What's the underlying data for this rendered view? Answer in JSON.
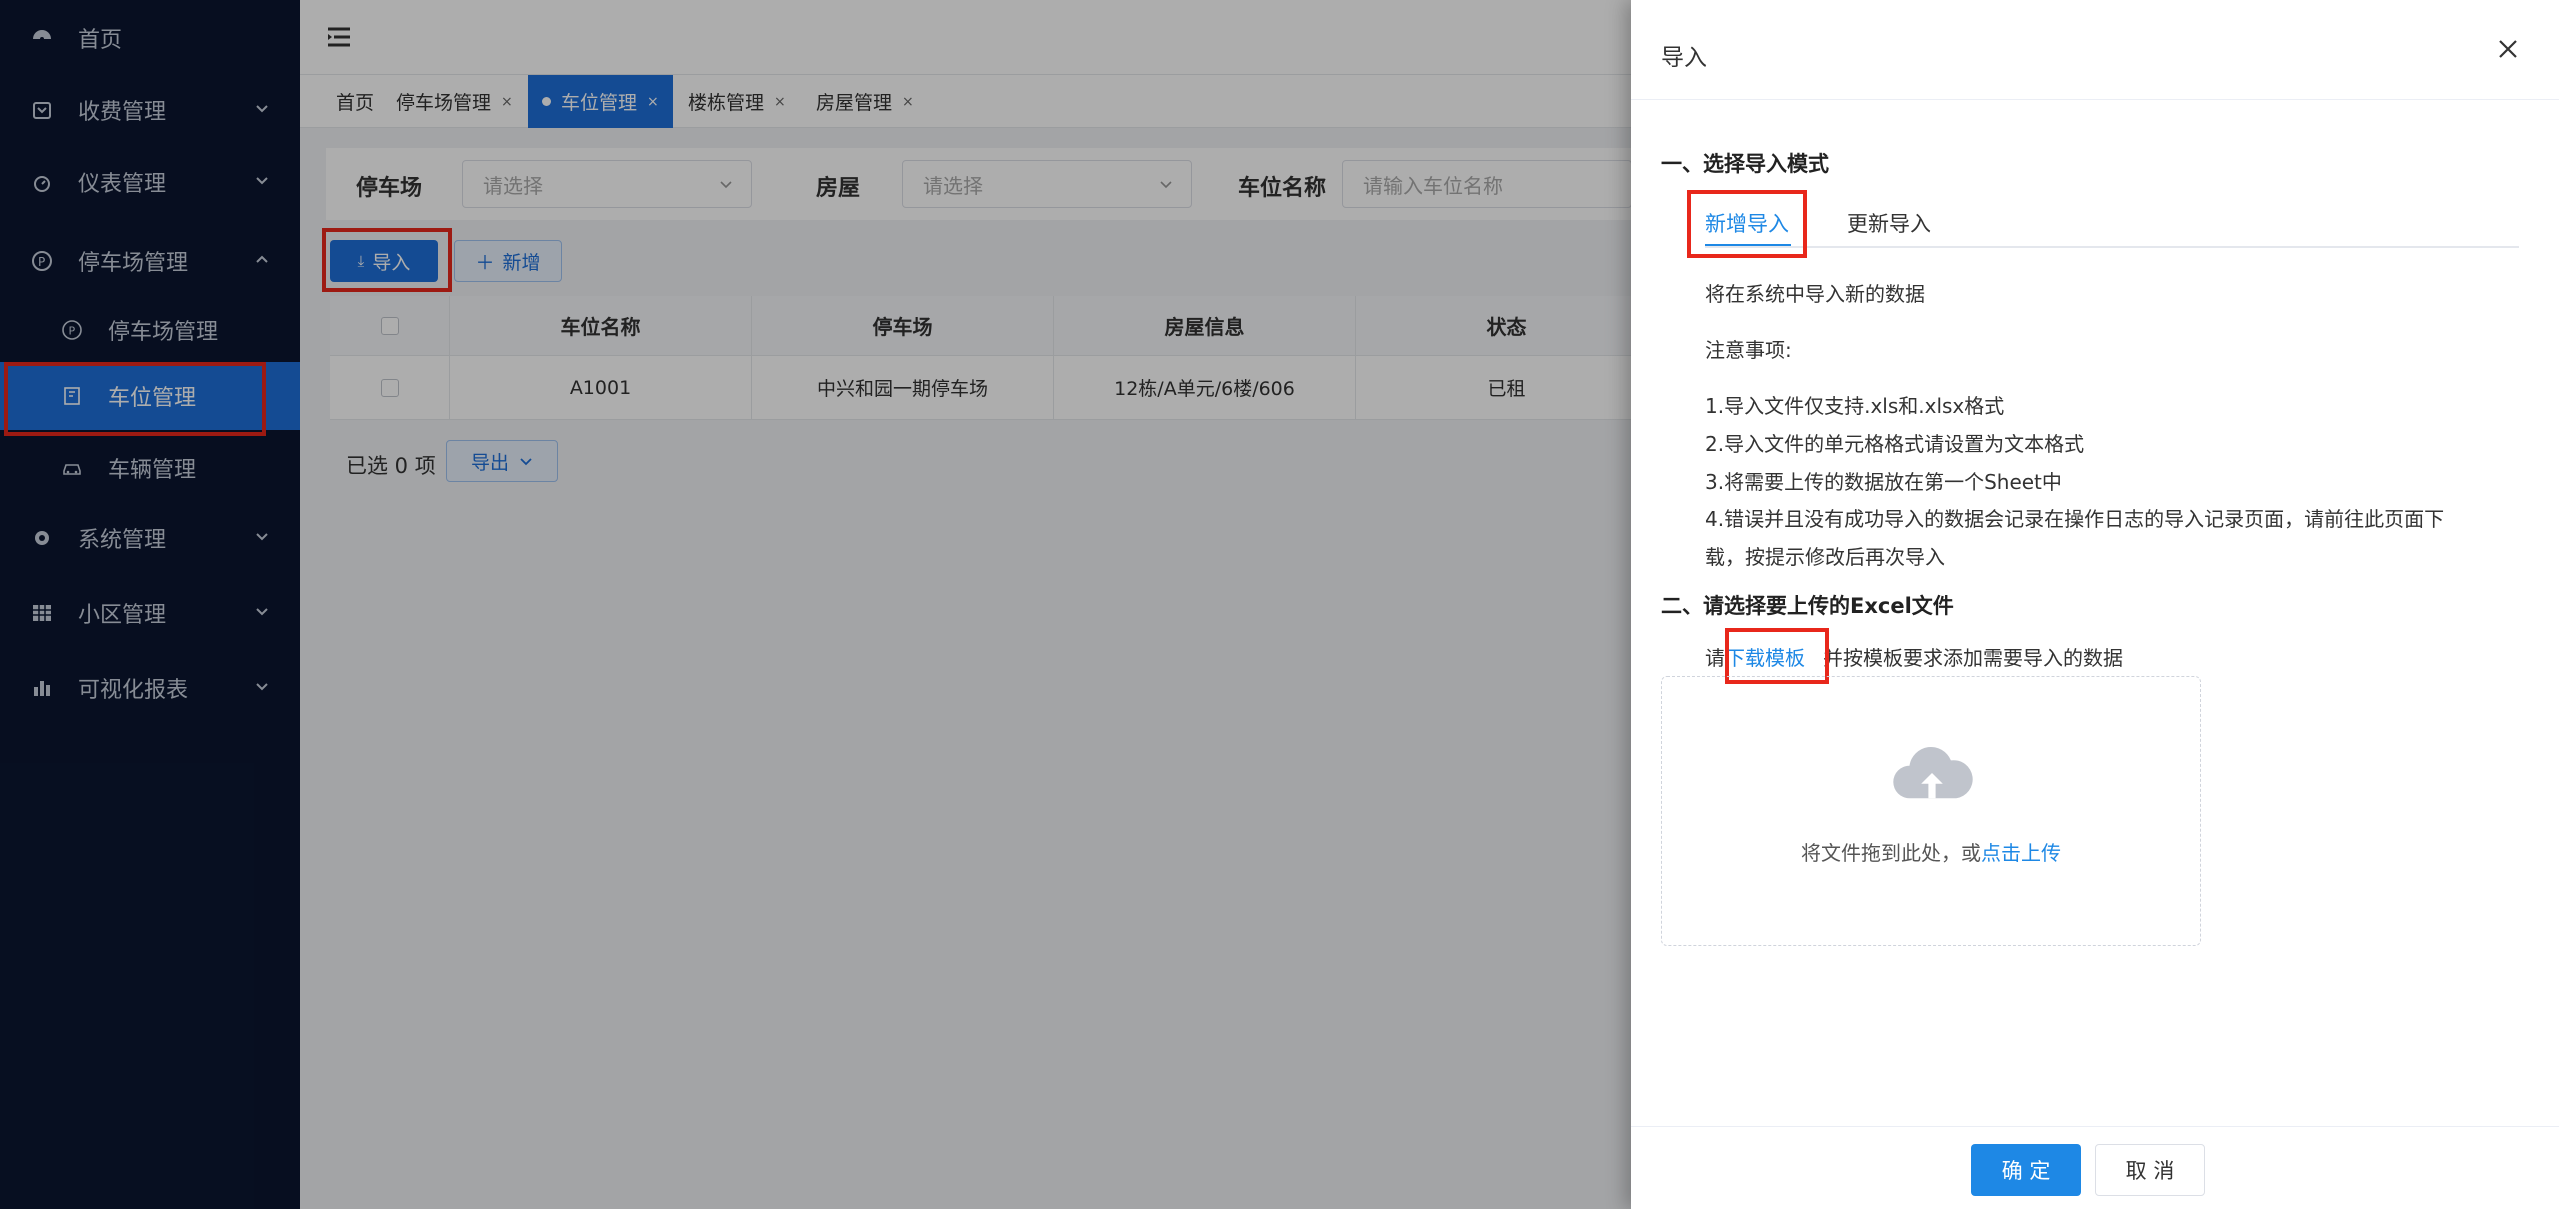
{
  "sidebar": {
    "items": [
      {
        "label": "首页",
        "icon": "dashboard-icon"
      },
      {
        "label": "收费管理",
        "icon": "wallet-icon"
      },
      {
        "label": "仪表管理",
        "icon": "gauge-icon"
      },
      {
        "label": "停车场管理",
        "icon": "parking-icon"
      },
      {
        "label": "停车场管理",
        "icon": "parking-circle-icon"
      },
      {
        "label": "车位管理",
        "icon": "parking-space-icon"
      },
      {
        "label": "车辆管理",
        "icon": "car-icon"
      },
      {
        "label": "系统管理",
        "icon": "gear-icon"
      },
      {
        "label": "小区管理",
        "icon": "grid-icon"
      },
      {
        "label": "可视化报表",
        "icon": "bar-chart-icon"
      }
    ]
  },
  "tabs": [
    {
      "label": "首页"
    },
    {
      "label": "停车场管理",
      "close": "×"
    },
    {
      "label": "车位管理",
      "close": "×"
    },
    {
      "label": "楼栋管理",
      "close": "×"
    },
    {
      "label": "房屋管理",
      "close": "×"
    }
  ],
  "filters": {
    "parking_label": "停车场",
    "parking_placeholder": "请选择",
    "house_label": "房屋",
    "house_placeholder": "请选择",
    "space_label": "车位名称",
    "space_placeholder": "请输入车位名称"
  },
  "toolbar": {
    "import_label": "导入",
    "add_label": "新增"
  },
  "table": {
    "headers": [
      "车位名称",
      "停车场",
      "房屋信息",
      "状态"
    ],
    "rows": [
      [
        "A1001",
        "中兴和园一期停车场",
        "12栋/A单元/6楼/606",
        "已租"
      ]
    ]
  },
  "footer": {
    "selected": "已选 0 项",
    "export_label": "导出"
  },
  "drawer": {
    "title": "导入",
    "section1": "一、选择导入模式",
    "mode_new": "新增导入",
    "mode_update": "更新导入",
    "desc": "将在系统中导入新的数据",
    "notes_title": "注意事项:",
    "note1": "1.导入文件仅支持.xls和.xlsx格式",
    "note2": "2.导入文件的单元格格式请设置为文本格式",
    "note3": "3.将需要上传的数据放在第一个Sheet中",
    "note4a": "4.错误并且没有成功导入的数据会记录在操作日志的导入记录页面，请前往此页面下",
    "note4b": "载，按提示修改后再次导入",
    "section2": "二、请选择要上传的Excel文件",
    "download_prefix": "请",
    "download_link": "下载模板",
    "download_suffix": "并按模板要求添加需要导入的数据",
    "upload_text": "将文件拖到此处，或",
    "upload_link": "点击上传",
    "confirm": "确 定",
    "cancel": "取 消"
  },
  "colors": {
    "primary": "#1e6fd9",
    "sidebar": "#0b1630",
    "highlight": "#e8271b"
  }
}
